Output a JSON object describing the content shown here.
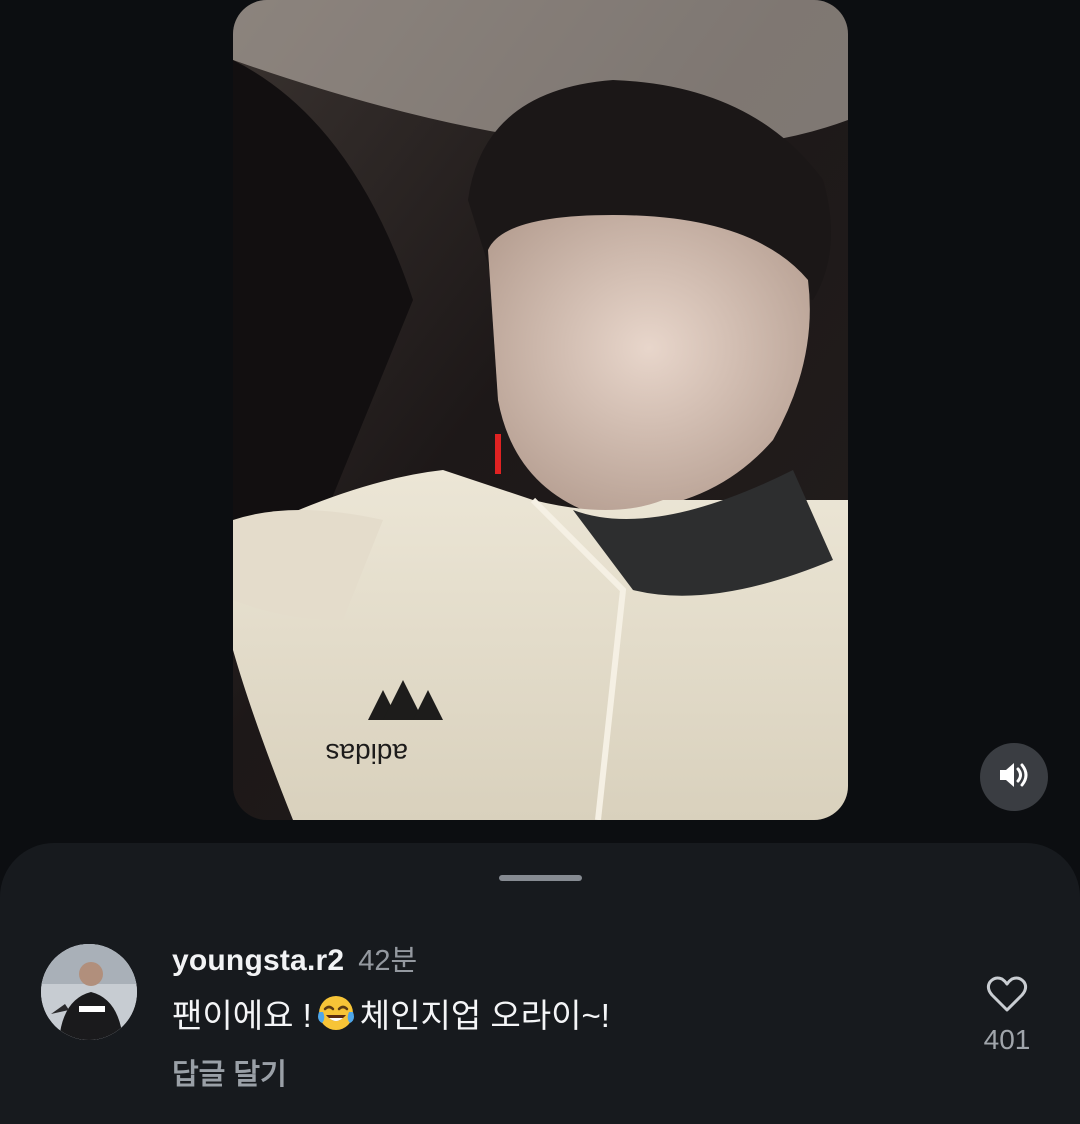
{
  "video": {
    "logo_text": "adidas"
  },
  "icons": {
    "volume": "volume-on-icon",
    "heart": "heart-outline-icon",
    "emoji": "face-with-tears-of-joy-icon"
  },
  "colors": {
    "background": "#0c0e11",
    "sheet": "#171a1e",
    "primary_text": "#f2f3f5",
    "secondary_text": "#9499a0"
  },
  "comment": {
    "username": "youngsta.r2",
    "time": "42분",
    "text_before_emoji": "팬이에요 !",
    "text_after_emoji": " 체인지업 오라이~!",
    "reply_label": "답글 달기",
    "like_count": "401"
  }
}
